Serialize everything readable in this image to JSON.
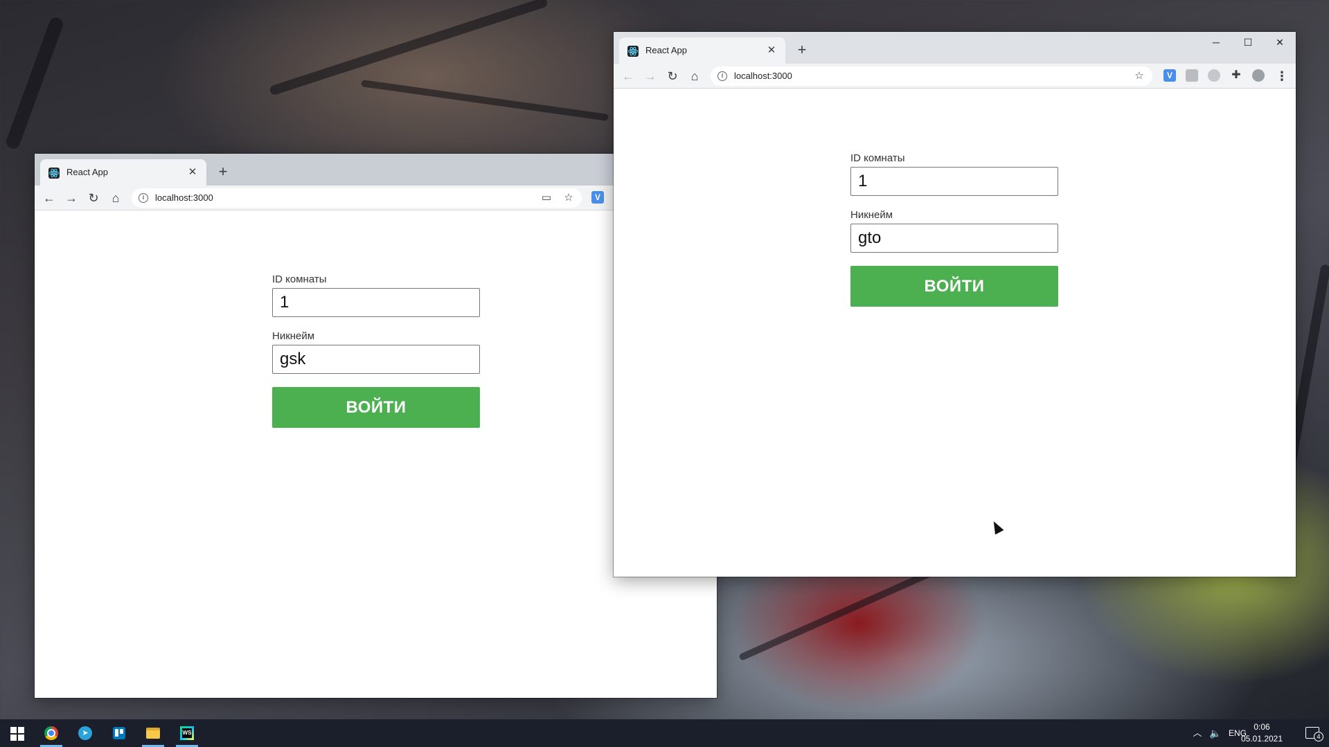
{
  "left_window": {
    "tab_title": "React App",
    "url": "localhost:3000",
    "form": {
      "room_label": "ID комнаты",
      "room_value": "1",
      "nickname_label": "Никнейм",
      "nickname_value": "gsk",
      "submit_label": "ВОЙТИ"
    }
  },
  "right_window": {
    "tab_title": "React App",
    "url": "localhost:3000",
    "form": {
      "room_label": "ID комнаты",
      "room_value": "1",
      "nickname_label": "Никнейм",
      "nickname_value": "gto",
      "submit_label": "ВОЙТИ"
    }
  },
  "taskbar": {
    "language": "ENG",
    "time": "0:06",
    "date": "05.01.2021",
    "notification_count": "4",
    "apps": [
      "chrome",
      "telegram",
      "trello",
      "file-explorer",
      "webstorm"
    ]
  },
  "colors": {
    "accent_green": "#4caf50",
    "taskbar": "#1b1f2b"
  }
}
